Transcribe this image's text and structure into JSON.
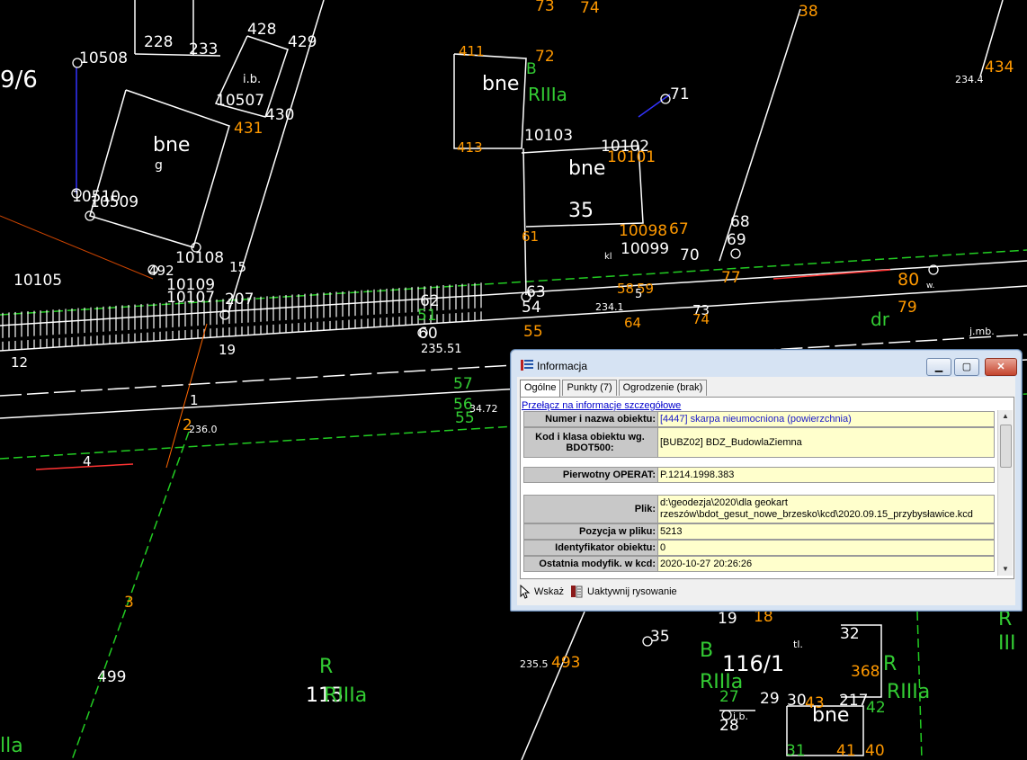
{
  "map": {
    "labels": [
      {
        "t": "9/6",
        "c": "#ffffff"
      },
      {
        "t": "10508",
        "c": "#ffffff"
      },
      {
        "t": "233",
        "c": "#ffffff"
      },
      {
        "t": "228",
        "c": "#ffffff"
      },
      {
        "t": "i.b.",
        "c": "#ffffff"
      },
      {
        "t": "428",
        "c": "#ffffff"
      },
      {
        "t": "429",
        "c": "#ffffff"
      },
      {
        "t": "10507",
        "c": "#ffffff"
      },
      {
        "t": "430",
        "c": "#ffffff"
      },
      {
        "t": "431",
        "c": "#ff9900"
      },
      {
        "t": "bne",
        "c": "#ffffff"
      },
      {
        "t": "g",
        "c": "#ffffff"
      },
      {
        "t": "10510",
        "c": "#ffffff"
      },
      {
        "t": "10509",
        "c": "#ffffff"
      },
      {
        "t": "10108",
        "c": "#ffffff"
      },
      {
        "t": "15",
        "c": "#ffffff"
      },
      {
        "t": "492",
        "c": "#ffffff"
      },
      {
        "t": "10109",
        "c": "#ffffff"
      },
      {
        "t": "10107",
        "c": "#ffffff"
      },
      {
        "t": "10105",
        "c": "#ffffff"
      },
      {
        "t": "207",
        "c": "#ffffff"
      },
      {
        "t": "19",
        "c": "#ffffff"
      },
      {
        "t": "12",
        "c": "#ffffff"
      },
      {
        "t": "411",
        "c": "#ff9900"
      },
      {
        "t": "72",
        "c": "#ff9900"
      },
      {
        "t": "B",
        "c": "#33cc33"
      },
      {
        "t": "bne",
        "c": "#ffffff"
      },
      {
        "t": "RIIIa",
        "c": "#33cc33"
      },
      {
        "t": "413",
        "c": "#ff9900"
      },
      {
        "t": "10103",
        "c": "#ffffff"
      },
      {
        "t": "10102",
        "c": "#ffffff"
      },
      {
        "t": "10101",
        "c": "#ff9900"
      },
      {
        "t": "bne",
        "c": "#ffffff"
      },
      {
        "t": "35",
        "c": "#ffffff"
      },
      {
        "t": "71",
        "c": "#ffffff"
      },
      {
        "t": "61",
        "c": "#ff9900"
      },
      {
        "t": "10098",
        "c": "#ff9900"
      },
      {
        "t": "10099",
        "c": "#ffffff"
      },
      {
        "t": "67",
        "c": "#ff9900"
      },
      {
        "t": "70",
        "c": "#ffffff"
      },
      {
        "t": "68",
        "c": "#ffffff"
      },
      {
        "t": "69",
        "c": "#ffffff"
      },
      {
        "t": "62",
        "c": "#ffffff"
      },
      {
        "t": "63",
        "c": "#ffffff"
      },
      {
        "t": "54",
        "c": "#ffffff"
      },
      {
        "t": "51",
        "c": "#33cc33"
      },
      {
        "t": "60",
        "c": "#ffffff"
      },
      {
        "t": "55",
        "c": "#ff9900"
      },
      {
        "t": "235.51",
        "c": "#ffffff"
      },
      {
        "t": "58",
        "c": "#ff9900"
      },
      {
        "t": "59",
        "c": "#ff9900"
      },
      {
        "t": "64",
        "c": "#ff9900"
      },
      {
        "t": "234.1",
        "c": "#ffffff"
      },
      {
        "t": "73",
        "c": "#ffffff"
      },
      {
        "t": "74",
        "c": "#ff9900"
      },
      {
        "t": "77",
        "c": "#ff9900"
      },
      {
        "t": "80",
        "c": "#ff9900"
      },
      {
        "t": "79",
        "c": "#ff9900"
      },
      {
        "t": "dr",
        "c": "#33cc33"
      },
      {
        "t": "j.mb.",
        "c": "#ffffff"
      },
      {
        "t": "w.",
        "c": "#ffffff"
      },
      {
        "t": "234.4",
        "c": "#ffffff"
      },
      {
        "t": "434",
        "c": "#ff9900"
      },
      {
        "t": "38",
        "c": "#ff9900"
      },
      {
        "t": "73",
        "c": "#ff9900"
      },
      {
        "t": "74",
        "c": "#ff9900"
      },
      {
        "t": "1",
        "c": "#ffffff"
      },
      {
        "t": "2",
        "c": "#ff9900"
      },
      {
        "t": "236.0",
        "c": "#ffffff"
      },
      {
        "t": "4",
        "c": "#ffffff"
      },
      {
        "t": "3",
        "c": "#ff9900"
      },
      {
        "t": "499",
        "c": "#ffffff"
      },
      {
        "t": "R",
        "c": "#33cc33"
      },
      {
        "t": "115",
        "c": "#ffffff"
      },
      {
        "t": "RIIIa",
        "c": "#33cc33"
      },
      {
        "t": "lla",
        "c": "#33cc33"
      },
      {
        "t": "235.5",
        "c": "#ffffff"
      },
      {
        "t": "493",
        "c": "#ff9900"
      },
      {
        "t": "57",
        "c": "#33cc33"
      },
      {
        "t": "56",
        "c": "#33cc33"
      },
      {
        "t": "55",
        "c": "#33cc33"
      },
      {
        "t": "34.72",
        "c": "#ffffff"
      },
      {
        "t": "19",
        "c": "#ffffff"
      },
      {
        "t": "18",
        "c": "#ff9900"
      },
      {
        "t": "B",
        "c": "#33cc33"
      },
      {
        "t": "RIIIa",
        "c": "#33cc33"
      },
      {
        "t": "116/1",
        "c": "#ffffff"
      },
      {
        "t": "tl.",
        "c": "#ffffff"
      },
      {
        "t": "32",
        "c": "#ffffff"
      },
      {
        "t": "368",
        "c": "#ff9900"
      },
      {
        "t": "R",
        "c": "#33cc33"
      },
      {
        "t": "RIIIa",
        "c": "#33cc33"
      },
      {
        "t": "27",
        "c": "#33cc33"
      },
      {
        "t": "29",
        "c": "#ffffff"
      },
      {
        "t": "30",
        "c": "#ffffff"
      },
      {
        "t": "43",
        "c": "#ff9900"
      },
      {
        "t": "217",
        "c": "#ffffff"
      },
      {
        "t": "bne",
        "c": "#ffffff"
      },
      {
        "t": "42",
        "c": "#33cc33"
      },
      {
        "t": "28",
        "c": "#ffffff"
      },
      {
        "t": "i.b.",
        "c": "#ffffff"
      },
      {
        "t": "31",
        "c": "#33cc33"
      },
      {
        "t": "41",
        "c": "#ff9900"
      },
      {
        "t": "40",
        "c": "#ff9900"
      },
      {
        "t": "R",
        "c": "#33cc33"
      },
      {
        "t": "III",
        "c": "#33cc33"
      },
      {
        "t": "35",
        "c": "#ffffff"
      },
      {
        "t": "kl",
        "c": "#ffffff"
      },
      {
        "t": "5",
        "c": "#ffffff"
      }
    ]
  },
  "window": {
    "title": "Informacja",
    "tabs": [
      "Ogólne",
      "Punkty (7)",
      "Ogrodzenie (brak)"
    ],
    "link": "Przełącz na informacje szczegółowe",
    "rows": [
      {
        "label": "Numer i nazwa obiektu:",
        "value": "[4447] skarpa nieumocniona (powierzchnia)",
        "style": "blue"
      },
      {
        "label": "Kod i klasa obiektu wg. BDOT500:",
        "value": "[BUBZ02] BDZ_BudowlaZiemna",
        "style": "plain"
      },
      {
        "label": "Pierwotny OPERAT:",
        "value": "P.1214.1998.383",
        "style": "plain"
      },
      {
        "label": "Plik:",
        "value": "d:\\geodezja\\2020\\dla geokart rzeszów\\bdot_gesut_nowe_brzesko\\kcd\\2020.09.15_przybysławice.kcd",
        "style": "plain"
      },
      {
        "label": "Pozycja w pliku:",
        "value": "5213",
        "style": "plain"
      },
      {
        "label": "Identyfikator obiektu:",
        "value": "0",
        "style": "plain"
      },
      {
        "label": "Ostatnia modyfik. w kcd:",
        "value": "2020-10-27 20:26:26",
        "style": "plain"
      }
    ],
    "footer": {
      "point_label": "Wskaż",
      "activate_label": "Uaktywnij rysowanie"
    },
    "colors": {
      "label_bg": "#c8c8c8",
      "value_bg": "#ffffcc",
      "link": "#0000cc"
    }
  }
}
